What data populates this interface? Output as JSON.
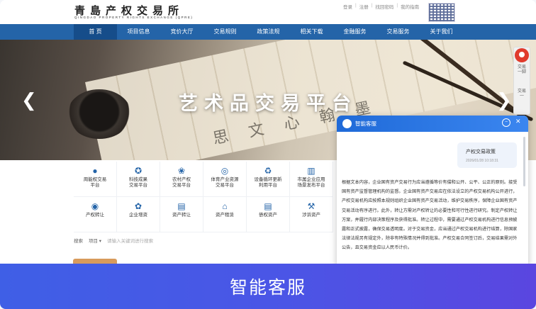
{
  "header": {
    "logo_cn": "青島产权交易所",
    "logo_en": "QINGDAO PROPERTY RIGHTS EXCHANGE (QPRE)",
    "top_links": [
      "登录",
      "注册",
      "找回密码",
      "我的指南"
    ]
  },
  "nav": {
    "items": [
      "首 页",
      "项目信息",
      "竞价大厅",
      "交易规则",
      "政策法规",
      "相关下载",
      "金融服务",
      "交易服务",
      "关于我们"
    ],
    "active_index": 0
  },
  "banner": {
    "title": "艺术品交易平台",
    "calligraphy": [
      "思",
      "文",
      "心",
      "翰",
      "墨"
    ]
  },
  "side_float": {
    "items": [
      "交易一脚",
      "交易一"
    ]
  },
  "services": {
    "row1": [
      {
        "label1": "周能权交易",
        "label2": "平台",
        "icon": "drop-icon"
      },
      {
        "label1": "科技成果",
        "label2": "交易平台",
        "icon": "medal-icon"
      },
      {
        "label1": "农村产权",
        "label2": "交易平台",
        "icon": "leaf-icon"
      },
      {
        "label1": "体育产业资源",
        "label2": "交易平台",
        "icon": "ball-icon"
      },
      {
        "label1": "设备循环更新",
        "label2": "利用平台",
        "icon": "recycle-icon"
      },
      {
        "label1": "市属企业应用",
        "label2": "场景发布平台",
        "icon": "building-icon"
      }
    ],
    "row2": [
      {
        "label": "产权转让",
        "icon": "coin-icon"
      },
      {
        "label": "企业增资",
        "icon": "flower-icon"
      },
      {
        "label": "资产转让",
        "icon": "bank-icon"
      },
      {
        "label": "资产租赁",
        "icon": "house-icon"
      },
      {
        "label": "债权资产",
        "icon": "doc-icon"
      },
      {
        "label": "涉诉资产",
        "icon": "gavel-icon"
      }
    ]
  },
  "search": {
    "label": "搜索",
    "dropdown": "项目 ▾",
    "placeholder": "请输入关键词进行搜索"
  },
  "chat": {
    "title": "智能客服",
    "user_message": "产权交易政策",
    "user_time": "2026/01/28 10:18:31",
    "answer": "根据文本内容，企业国有资产交易行为应当遵循等价有偿和公开、公平、公正的原则。接受国有资产监督管理机构的监督。企业国有资产交易应在依法设立的产权交易机构公开进行，产权交易机构应按照本规则组织企业国有资产交易活动，维护交易秩序，保障企业国有资产交易活动有序进行。此外，转让方需对产权转让的必要性和可行性进行研究。制定产权转让方案，并履行内部决策程序及获得批准。转让过程中，需要通过产权交易机构进行信息预披露和正式披露，确保交易透明度。对于交易资金，应当通过产权交易机构进行结算，除国家法律法规另有规定外，除非有特殊情况并得到批准。产权交易合同签订后，交易结果需对外公告，且交易资金应以人民币计价。"
  },
  "caption": "智能客服",
  "colors": {
    "nav_blue": "#2464a8",
    "chat_blue": "#1f6ad8",
    "caption_band": "#4a56e6"
  }
}
